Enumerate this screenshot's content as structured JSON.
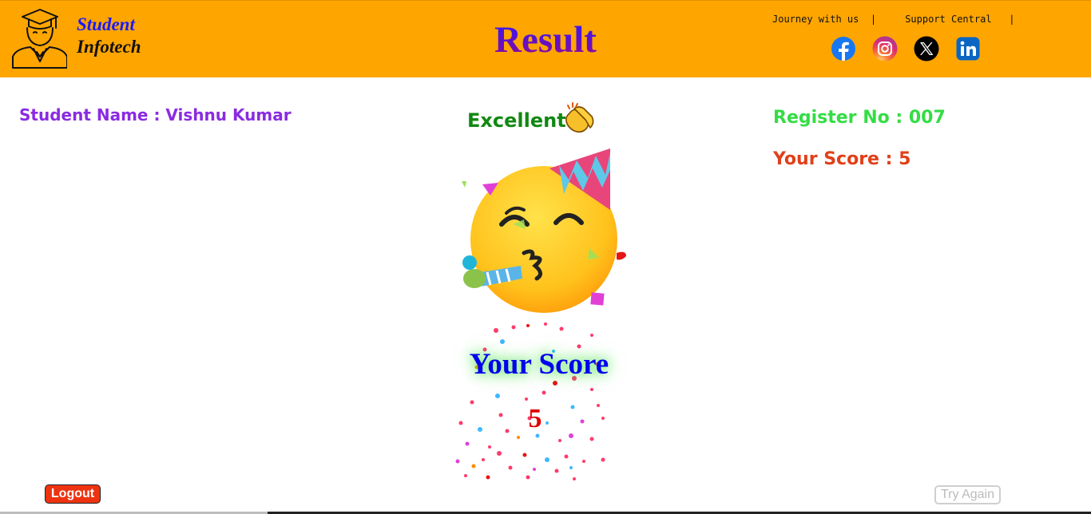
{
  "header": {
    "brand_line1": "Student",
    "brand_line2": "Infotech",
    "title": "Result",
    "links": {
      "journey": "Journey with us",
      "support": "Support Central",
      "separator": "|"
    },
    "social_icons": [
      "facebook-icon",
      "instagram-icon",
      "x-twitter-icon",
      "linkedin-icon"
    ],
    "colors": {
      "background": "#ffa500",
      "title": "#5a10c8"
    }
  },
  "student": {
    "name_label": "Student Name : Vishnu Kumar",
    "register_label": "Register No : 007",
    "score_label": "Your Score : 5"
  },
  "result": {
    "remark": "Excellent",
    "remark_icon": "clapping-hands-icon",
    "celebration_icon": "party-face-icon",
    "score_heading": "Your Score",
    "score_value": "5"
  },
  "actions": {
    "logout_label": "Logout",
    "try_again_label": "Try Again"
  }
}
